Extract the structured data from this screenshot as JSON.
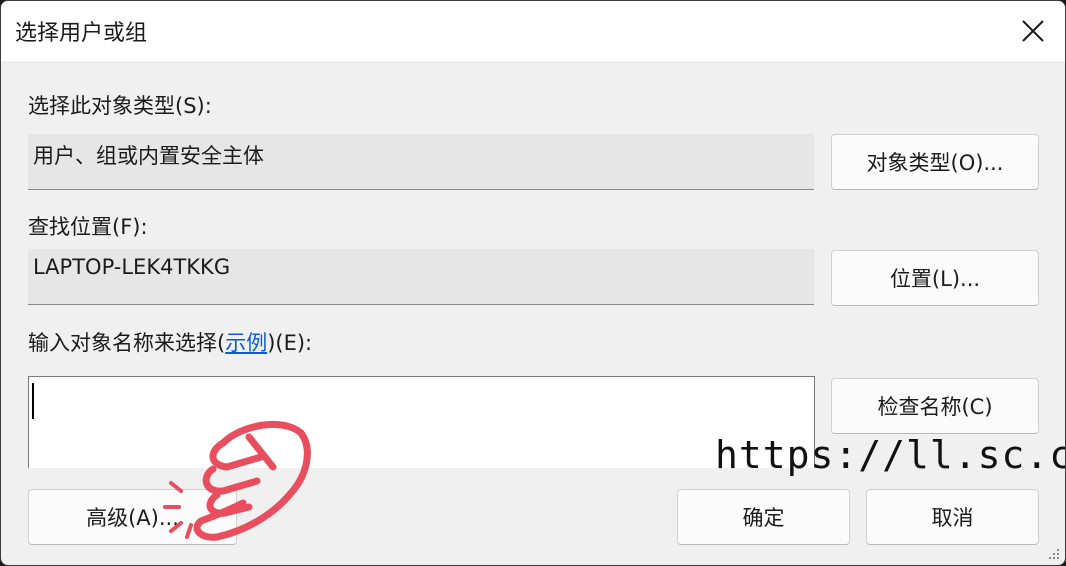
{
  "window": {
    "title": "选择用户或组"
  },
  "object_type": {
    "label": "选择此对象类型(S):",
    "value": "用户、组或内置安全主体",
    "button": "对象类型(O)..."
  },
  "location": {
    "label": "查找位置(F):",
    "value": "LAPTOP-LEK4TKKG",
    "button": "位置(L)..."
  },
  "names": {
    "label_prefix": "输入对象名称来选择(",
    "examples_link": "示例",
    "label_suffix": ")(E):",
    "value": "",
    "check_button": "检查名称(C)"
  },
  "buttons": {
    "advanced": "高级(A)...",
    "ok": "确定",
    "cancel": "取消"
  },
  "watermark": "https://ll.sc.cn",
  "colors": {
    "link": "#0b5bd3",
    "hand": "#e84e5e"
  }
}
